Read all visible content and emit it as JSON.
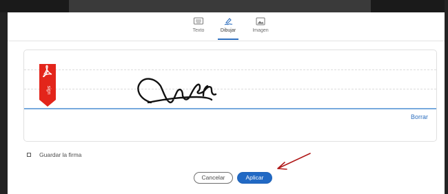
{
  "tabs": [
    {
      "label": "Texto",
      "icon": "keyboard-icon",
      "active": false
    },
    {
      "label": "Dibujar",
      "icon": "pen-draw-icon",
      "active": true
    },
    {
      "label": "Imagen",
      "icon": "image-icon",
      "active": false
    }
  ],
  "signature_area": {
    "clear_label": "Borrar",
    "badge_icon": "adobe-acrobat-icon",
    "badge_text": "sign"
  },
  "save_signature": {
    "label": "Guardar la firma",
    "checked": false
  },
  "buttons": {
    "cancel_label": "Cancelar",
    "apply_label": "Aplicar"
  },
  "colors": {
    "accent": "#2169c4",
    "badge_red": "#e3251b",
    "annotation_arrow": "#b01818"
  }
}
